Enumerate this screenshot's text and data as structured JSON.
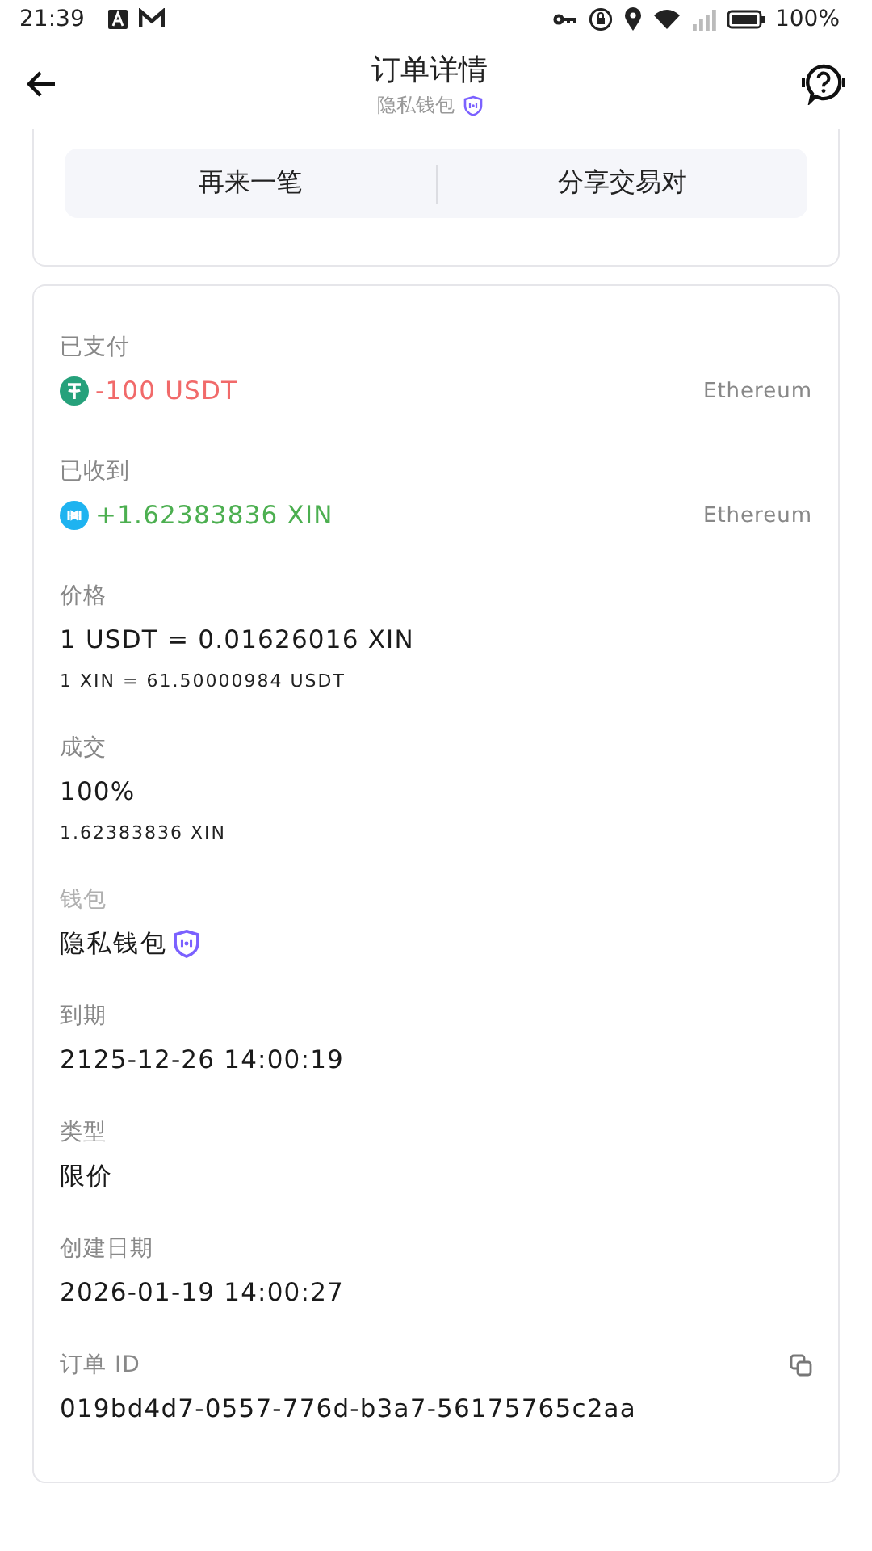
{
  "status_bar": {
    "time": "21:39",
    "battery": "100%"
  },
  "header": {
    "title": "订单详情",
    "subtitle": "隐私钱包"
  },
  "actions": [
    "再来一笔",
    "分享交易对"
  ],
  "details": [
    {
      "kind": "asset",
      "label": "已支付",
      "amount": "-100 USDT",
      "color": "#f16a6a",
      "chain": "Ethereum"
    },
    {
      "kind": "asset",
      "label": "已收到",
      "amount": "+1.62383836 XIN",
      "color": "#4caf50",
      "chain": "Ethereum"
    },
    {
      "kind": "text",
      "label": "价格",
      "value": "1 USDT = 0.01626016 XIN",
      "sub": "1 XIN = 61.50000984 USDT"
    },
    {
      "kind": "text",
      "label": "成交",
      "value": "100%",
      "sub": "1.62383836 XIN"
    },
    {
      "kind": "wallet",
      "label": "钱包",
      "value": "隐私钱包"
    },
    {
      "kind": "text",
      "label": "到期",
      "value": "2125-12-26 14:00:19"
    },
    {
      "kind": "text",
      "label": "类型",
      "value": "限价"
    },
    {
      "kind": "text",
      "label": "创建日期",
      "value": "2026-01-19 14:00:27"
    },
    {
      "kind": "copy",
      "label": "订单 ID",
      "value": "019bd4d7-0557-776d-b3a7-56175765c2aa"
    }
  ]
}
